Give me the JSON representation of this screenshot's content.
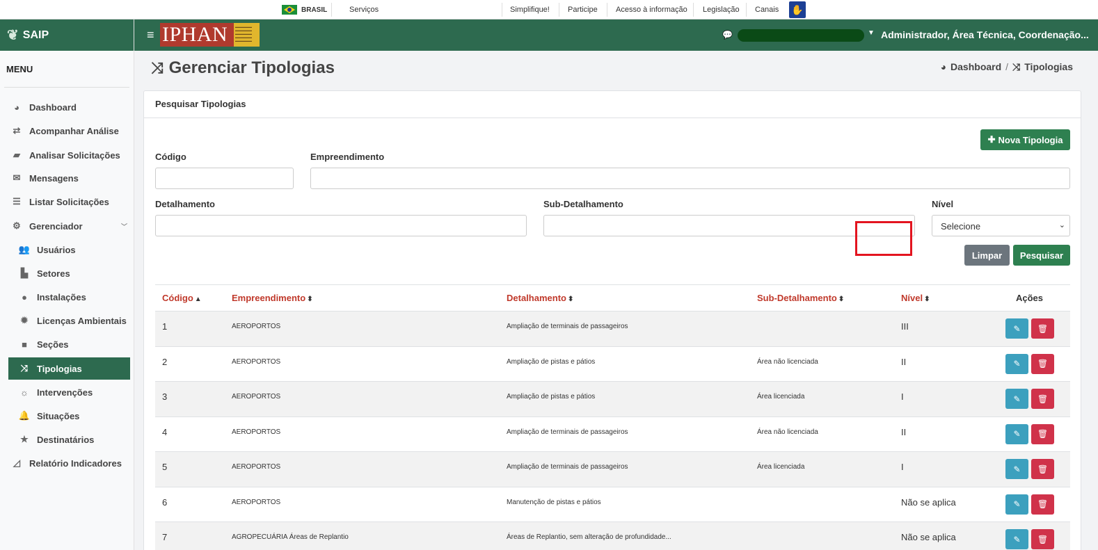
{
  "gov_bar": {
    "brasil": "BRASIL",
    "servicos": "Serviços",
    "links": [
      "Simplifique!",
      "Participe",
      "Acesso à informação",
      "Legislação",
      "Canais"
    ]
  },
  "sidebar": {
    "app_name": "SAIP",
    "menu_title": "MENU",
    "items": [
      {
        "label": "Dashboard",
        "icon": "dashboard-icon"
      },
      {
        "label": "Acompanhar Análise",
        "icon": "exchange-icon"
      },
      {
        "label": "Analisar Solicitações",
        "icon": "book-icon"
      },
      {
        "label": "Mensagens",
        "icon": "comments-icon"
      },
      {
        "label": "Listar Solicitações",
        "icon": "list-icon"
      },
      {
        "label": "Gerenciador",
        "icon": "cogs-icon"
      },
      {
        "label": "Usuários",
        "icon": "users-icon"
      },
      {
        "label": "Setores",
        "icon": "industry-icon"
      },
      {
        "label": "Instalações",
        "icon": "circle-icon"
      },
      {
        "label": "Licenças Ambientais",
        "icon": "certificate-icon"
      },
      {
        "label": "Seções",
        "icon": "square-icon"
      },
      {
        "label": "Tipologias",
        "icon": "random-icon"
      },
      {
        "label": "Intervenções",
        "icon": "sun-icon"
      },
      {
        "label": "Situações",
        "icon": "bell-icon"
      },
      {
        "label": "Destinatários",
        "icon": "star-icon"
      },
      {
        "label": "Relatório Indicadores",
        "icon": "area-chart-icon"
      }
    ]
  },
  "header": {
    "logo_text": "IPHAN",
    "user_role": "Administrador, Área Técnica, Coordenação..."
  },
  "page": {
    "title": "Gerenciar Tipologias",
    "breadcrumb": [
      "Dashboard",
      "Tipologias"
    ]
  },
  "search": {
    "card_title": "Pesquisar Tipologias",
    "new_button": "Nova Tipologia",
    "fields": {
      "codigo": "Código",
      "empreendimento": "Empreendimento",
      "detalhamento": "Detalhamento",
      "sub_detalhamento": "Sub-Detalhamento",
      "nivel": "Nível"
    },
    "nivel_selected": "Selecione",
    "clear_button": "Limpar",
    "search_button": "Pesquisar"
  },
  "table": {
    "columns": [
      "Código",
      "Empreendimento",
      "Detalhamento",
      "Sub-Detalhamento",
      "Nível",
      "Ações"
    ],
    "rows": [
      {
        "codigo": "1",
        "empreendimento": "AEROPORTOS",
        "detalhamento": "Ampliação de terminais de passageiros",
        "sub": "",
        "nivel": "III"
      },
      {
        "codigo": "2",
        "empreendimento": "AEROPORTOS",
        "detalhamento": "Ampliação de pistas e pátios",
        "sub": "Área não licenciada",
        "nivel": "II"
      },
      {
        "codigo": "3",
        "empreendimento": "AEROPORTOS",
        "detalhamento": "Ampliação de pistas e pátios",
        "sub": "Área licenciada",
        "nivel": "I"
      },
      {
        "codigo": "4",
        "empreendimento": "AEROPORTOS",
        "detalhamento": "Ampliação de terminais de passageiros",
        "sub": "Área não licenciada",
        "nivel": "II"
      },
      {
        "codigo": "5",
        "empreendimento": "AEROPORTOS",
        "detalhamento": "Ampliação de terminais de passageiros",
        "sub": "Área licenciada",
        "nivel": "I"
      },
      {
        "codigo": "6",
        "empreendimento": "AEROPORTOS",
        "detalhamento": "Manutenção de pistas e pátios",
        "sub": "",
        "nivel": "Não se aplica"
      },
      {
        "codigo": "7",
        "empreendimento": "AGROPECUÁRIA Áreas de Replantio",
        "detalhamento": "Áreas de Replantio, sem alteração de profundidade...",
        "sub": "",
        "nivel": "Não se aplica"
      }
    ]
  },
  "colors": {
    "primary_green": "#2d6a4f",
    "header_link_red": "#c0392b",
    "edit_blue": "#3ca0be",
    "delete_red": "#d0324a",
    "highlight_red": "#e3141f"
  }
}
